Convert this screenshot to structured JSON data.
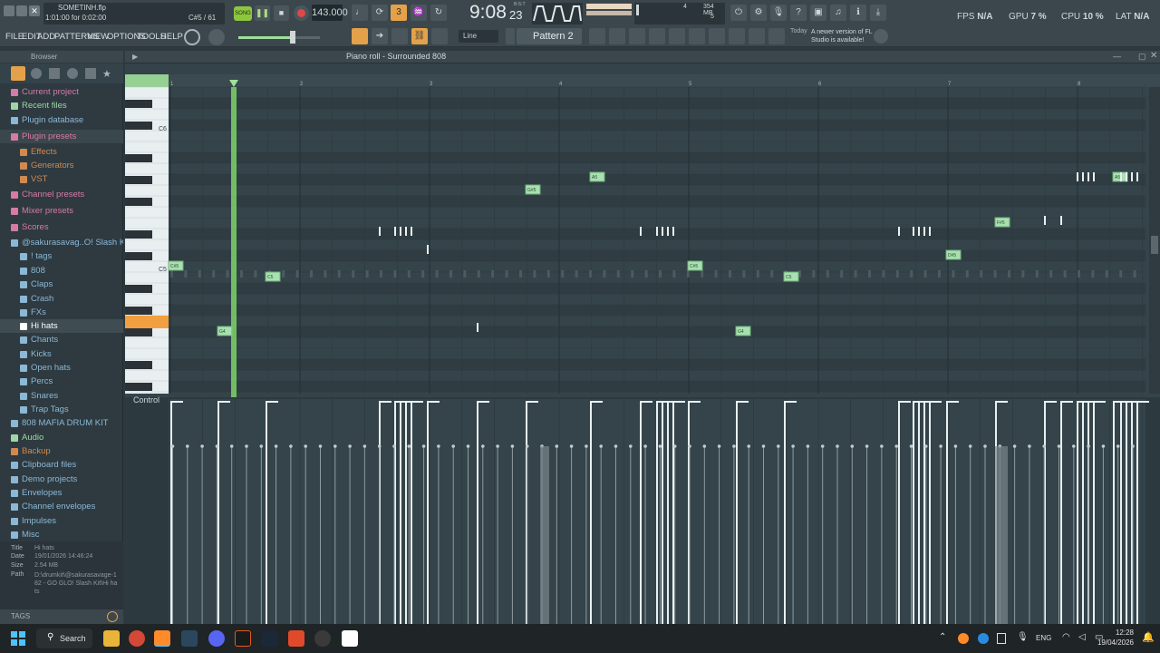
{
  "window": {
    "project_file": "SOMETINH.flp",
    "song_pos": "1:01:00 for 0:02:00",
    "channel_info": "C#5 / 61",
    "song_mode": "SONG",
    "tempo": "143.000",
    "time_display": "9:08",
    "time_display_small": "23",
    "time_suffix": "B:S:T",
    "cpu_mem": "354 MB",
    "poly": "4",
    "poly2": "5",
    "pattern": "Pattern 2",
    "snap": "Line",
    "update_notice_day": "Today",
    "update_notice": "A newer version of FL Studio is available!"
  },
  "stats": {
    "fps_label": "FPS",
    "fps": "N/A",
    "gpu_label": "GPU",
    "gpu": "7 %",
    "cpu_label": "CPU",
    "cpu": "10 %",
    "lat_label": "LAT",
    "lat": "N/A"
  },
  "menu": [
    "FILE",
    "EDIT",
    "ADD",
    "PATTERNS",
    "VIEW",
    "OPTIONS",
    "TOOLS",
    "HELP"
  ],
  "browser": {
    "title": "Browser",
    "items": [
      {
        "label": "Current project",
        "color": "#d67aa8"
      },
      {
        "label": "Recent files",
        "color": "#9fd6a6"
      },
      {
        "label": "Plugin database",
        "color": "#8bb8d6"
      },
      {
        "label": "Plugin presets",
        "color": "#d67aa8"
      },
      {
        "label": "Effects",
        "color": "#d08a50"
      },
      {
        "label": "Generators",
        "color": "#d08a50"
      },
      {
        "label": "VST",
        "color": "#d08a50"
      },
      {
        "label": "Channel presets",
        "color": "#d67aa8"
      },
      {
        "label": "Mixer presets",
        "color": "#d67aa8"
      },
      {
        "label": "Scores",
        "color": "#d67aa8"
      },
      {
        "label": "@sakurasavag..O! Slash Kit",
        "color": "#8bb8d6"
      },
      {
        "label": "! tags",
        "color": "#8bb8d6"
      },
      {
        "label": "808",
        "color": "#8bb8d6"
      },
      {
        "label": "Claps",
        "color": "#8bb8d6"
      },
      {
        "label": "Crash",
        "color": "#8bb8d6"
      },
      {
        "label": "FXs",
        "color": "#8bb8d6"
      },
      {
        "label": "Hi hats",
        "color": "#ffffff"
      },
      {
        "label": "Chants",
        "color": "#8bb8d6"
      },
      {
        "label": "Kicks",
        "color": "#8bb8d6"
      },
      {
        "label": "Open hats",
        "color": "#8bb8d6"
      },
      {
        "label": "Percs",
        "color": "#8bb8d6"
      },
      {
        "label": "Snares",
        "color": "#8bb8d6"
      },
      {
        "label": "Trap Tags",
        "color": "#8bb8d6"
      },
      {
        "label": "808 MAFIA DRUM KIT",
        "color": "#8bb8d6"
      },
      {
        "label": "Audio",
        "color": "#9fd6a6"
      },
      {
        "label": "Backup",
        "color": "#d08a50"
      },
      {
        "label": "Clipboard files",
        "color": "#8bb8d6"
      },
      {
        "label": "Demo projects",
        "color": "#8bb8d6"
      },
      {
        "label": "Envelopes",
        "color": "#8bb8d6"
      },
      {
        "label": "Channel envelopes",
        "color": "#8bb8d6"
      },
      {
        "label": "Impulses",
        "color": "#8bb8d6"
      },
      {
        "label": "Misc",
        "color": "#8bb8d6"
      }
    ],
    "info_keys": [
      "Title",
      "Date",
      "Size",
      "Path"
    ],
    "info_vals": [
      "Hi hats",
      "19/01/2026 14:46:24",
      "2.54 MB",
      "D:\\drumkit\\@sakurasavage-182 - GO GLO! Slash Kit\\Hi hats"
    ],
    "tags": "TAGS"
  },
  "piano_roll": {
    "title": "Piano roll - Surrounded 808",
    "bars": [
      "1",
      "2",
      "3",
      "4",
      "5",
      "6",
      "7",
      "8"
    ],
    "key_labels": [
      "C6",
      "C5"
    ],
    "control_label": "Control",
    "note_labels": {
      "cs5": "C#5",
      "c5": "C5",
      "g4": "G4",
      "gs5": "G#5",
      "a5": "A5",
      "fs5": "F#5",
      "ds5": "D#5"
    }
  },
  "taskbar": {
    "search": "Search",
    "lang": "ENG",
    "time": "12:28",
    "date": "19/04/2026"
  },
  "colors": {
    "accent": "#9fe09a",
    "playhead": "#7ed36a",
    "note": "#a8e0b0"
  }
}
